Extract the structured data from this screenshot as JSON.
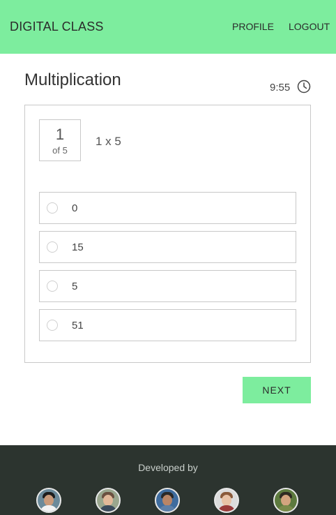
{
  "header": {
    "brand": "DIGITAL CLASS",
    "profile_label": "PROFILE",
    "logout_label": "LOGOUT",
    "accent_color": "#7ded9e"
  },
  "quiz": {
    "title": "Multiplication",
    "timer": "9:55",
    "timer_icon": "clock-icon",
    "question_number": "1",
    "question_of": "of 5",
    "question_text": "1 x 5",
    "options": [
      {
        "label": "0"
      },
      {
        "label": "15"
      },
      {
        "label": "5"
      },
      {
        "label": "51"
      }
    ],
    "next_label": "NEXT"
  },
  "footer": {
    "developed_by": "Developed by",
    "background_color": "#2c342f",
    "avatars": [
      "developer-avatar-1",
      "developer-avatar-2",
      "developer-avatar-3",
      "developer-avatar-4",
      "developer-avatar-5"
    ]
  }
}
